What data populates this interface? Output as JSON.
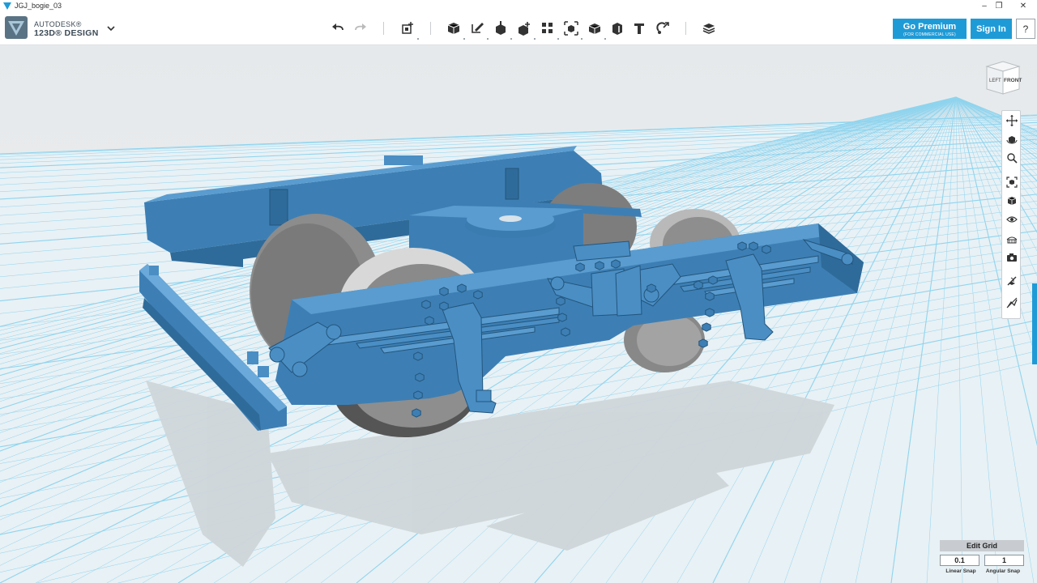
{
  "window": {
    "title": "JGJ_bogie_03",
    "controls": [
      "minimize",
      "restore",
      "close"
    ]
  },
  "brand": {
    "line1": "AUTODESK®",
    "line2": "123D® DESIGN"
  },
  "toolbar": {
    "tools": [
      {
        "name": "undo",
        "icon": "undo-icon"
      },
      {
        "name": "redo",
        "icon": "redo-icon"
      },
      {
        "name": "transform",
        "icon": "transform-icon"
      },
      {
        "name": "primitives",
        "icon": "primitives-icon"
      },
      {
        "name": "sketch",
        "icon": "sketch-icon"
      },
      {
        "name": "construct",
        "icon": "construct-icon"
      },
      {
        "name": "modify",
        "icon": "modify-icon"
      },
      {
        "name": "pattern",
        "icon": "pattern-icon"
      },
      {
        "name": "group",
        "icon": "group-icon"
      },
      {
        "name": "combine",
        "icon": "combine-icon"
      },
      {
        "name": "measure",
        "icon": "measure-icon"
      },
      {
        "name": "text",
        "icon": "text-icon"
      },
      {
        "name": "snap",
        "icon": "snap-icon"
      },
      {
        "name": "materials",
        "icon": "materials-icon"
      }
    ]
  },
  "account": {
    "premium_label": "Go Premium",
    "premium_sub": "(FOR COMMERCIAL USE)",
    "signin_label": "Sign In",
    "help_label": "?"
  },
  "viewcube": {
    "left": "LEFT",
    "front": "FRONT"
  },
  "nav": {
    "buttons": [
      "pan-icon",
      "orbit-icon",
      "zoom-icon",
      "fit-icon",
      "views-icon",
      "visibility-icon",
      "material-display-icon",
      "screenshot-icon",
      "grid-toggle-icon",
      "snap-toggle-icon"
    ]
  },
  "grid": {
    "header": "Edit Grid",
    "linear_value": "0.1",
    "angular_value": "1",
    "linear_label": "Linear Snap",
    "angular_label": "Angular Snap"
  },
  "colors": {
    "accent": "#1e9bd7",
    "model_blue": "#3f86bc",
    "wheel_gray": "#8c8c8c",
    "grid_line": "#8fd4ee"
  }
}
